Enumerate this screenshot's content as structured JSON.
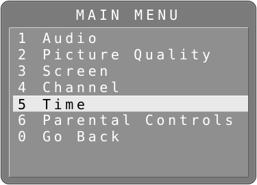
{
  "menu": {
    "title": "MAIN MENU",
    "items": [
      {
        "number": "1",
        "label": "Audio"
      },
      {
        "number": "2",
        "label": "Picture Quality"
      },
      {
        "number": "3",
        "label": "Screen"
      },
      {
        "number": "4",
        "label": "Channel"
      },
      {
        "number": "5",
        "label": "Time",
        "selected": true
      },
      {
        "number": "6",
        "label": "Parental Controls"
      },
      {
        "number": "0",
        "label": "Go Back"
      }
    ]
  },
  "colors": {
    "background": "#7b7b7b",
    "panel": "#8f8f8f",
    "highlight": "#e9e9e9",
    "text": "#ffffff",
    "selected_text": "#000000"
  }
}
